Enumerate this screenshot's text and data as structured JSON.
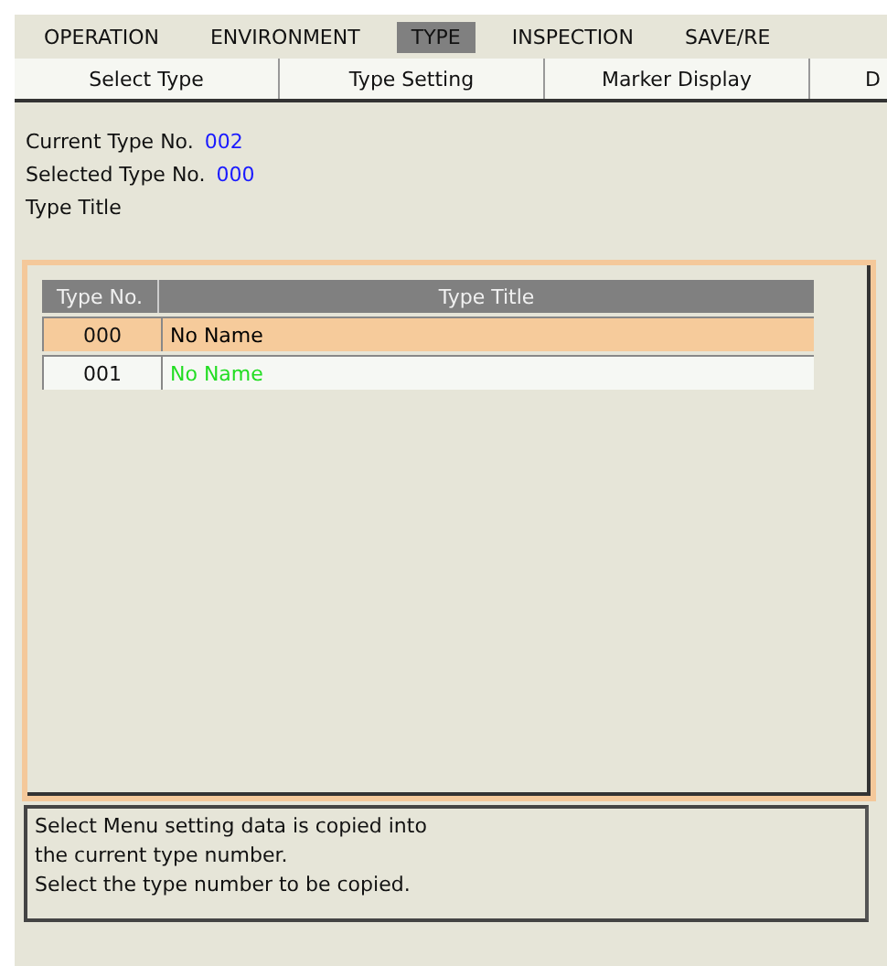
{
  "menu": [
    {
      "label": "OPERATION",
      "selected": false
    },
    {
      "label": "ENVIRONMENT",
      "selected": false
    },
    {
      "label": "TYPE",
      "selected": true
    },
    {
      "label": "INSPECTION",
      "selected": false
    },
    {
      "label": "SAVE/RE",
      "selected": false
    }
  ],
  "sub_tabs": [
    {
      "label": "Select Type"
    },
    {
      "label": "Type Setting"
    },
    {
      "label": "Marker Display"
    },
    {
      "label": "D"
    }
  ],
  "info": [
    {
      "label": "Current Type No.",
      "value": "002"
    },
    {
      "label": "Selected Type No.",
      "value": "000"
    },
    {
      "label": "Type Title"
    }
  ],
  "table": {
    "columns": [
      "Type No.",
      "Type Title"
    ],
    "rows": [
      {
        "number": "000",
        "title": "No Name",
        "selected": true,
        "color": "#000000"
      },
      {
        "number": "001",
        "title": "No Name",
        "selected": false,
        "color": "#22dd22"
      }
    ]
  },
  "message": [
    "Select Menu setting data is copied into",
    "the current type number.",
    "Select the type number to be copied."
  ]
}
